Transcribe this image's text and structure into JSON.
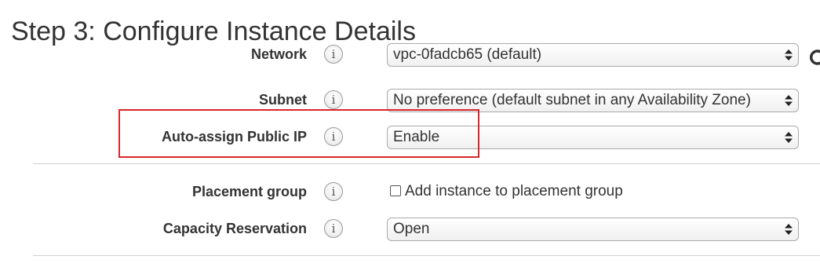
{
  "page": {
    "title": "Step 3: Configure Instance Details"
  },
  "form": {
    "network": {
      "label": "Network",
      "value": "vpc-0fadcb65 (default)",
      "info": "i"
    },
    "subnet": {
      "label": "Subnet",
      "value": "No preference (default subnet in any Availability Zone)",
      "info": "i"
    },
    "auto_assign_ip": {
      "label": "Auto-assign Public IP",
      "value": "Enable",
      "info": "i"
    },
    "placement_group": {
      "label": "Placement group",
      "checkbox_label": "Add instance to placement group",
      "checked": false,
      "info": "i"
    },
    "capacity_reservation": {
      "label": "Capacity Reservation",
      "value": "Open",
      "info": "i"
    }
  },
  "icons": {
    "info": "info-icon",
    "select_arrows": "chevron-up-down-icon",
    "refresh": "refresh-icon"
  },
  "colors": {
    "highlight": "#d9262b",
    "divider": "#d0d0d0"
  }
}
